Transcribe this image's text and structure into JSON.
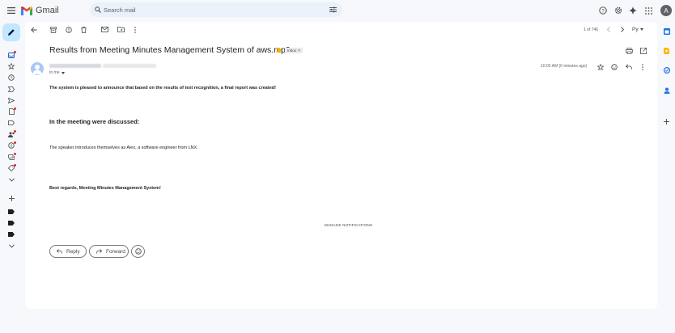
{
  "header": {
    "brand": "Gmail",
    "search_placeholder": "Search mail",
    "avatar_letter": "A"
  },
  "toolbar": {
    "pager": "1 of 746",
    "language": "Py"
  },
  "email": {
    "subject": "Results from Meeting Minutes Management System of aws.mp3",
    "label_chip": "Inbox",
    "to_line": "to me",
    "timestamp": "10:02 AM (0 minutes ago)",
    "intro": "The system is pleased to announce that based on the results of text recognition, a final report was created!",
    "heading": "In the meeting were discussed:",
    "summary": "The speaker introduces themselves as Alex, a software engineer from LNX.",
    "signature": "Best regards, Meeting Minutes Management System!",
    "manage_notifications": "MANAGE NOTIFICATIONS"
  },
  "actions": {
    "reply": "Reply",
    "forward": "Forward"
  },
  "colors": {
    "compose": "#c2e7ff",
    "accent_red": "#d93025",
    "important_yellow": "#f4b400",
    "side_yellow": "#fbbc04",
    "side_blue": "#1a73e8"
  }
}
